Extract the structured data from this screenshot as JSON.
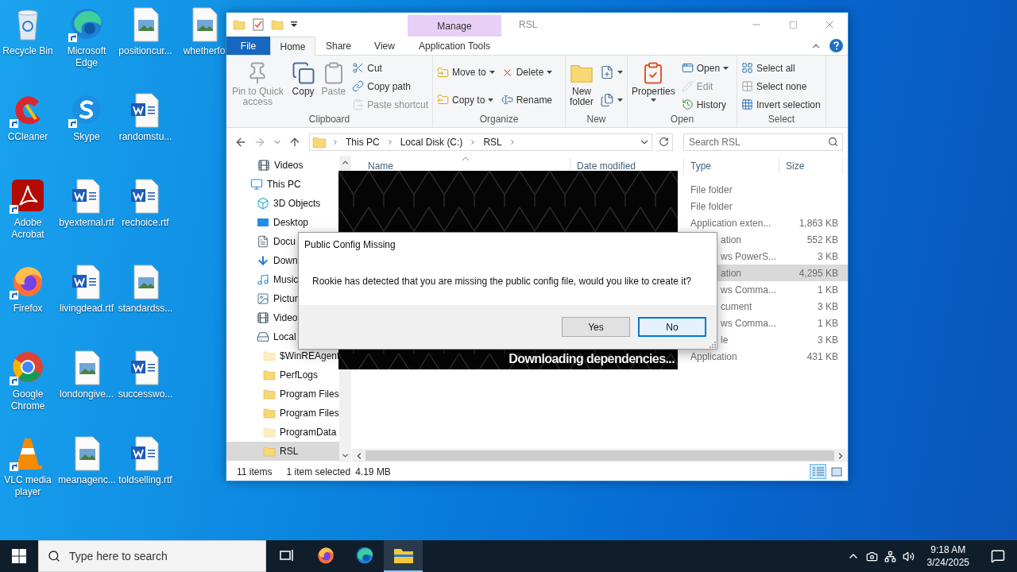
{
  "desktop_rows": [
    [
      {
        "label": "Recycle Bin",
        "kind": "recycle-bin",
        "shortcut": false
      },
      {
        "label": "Microsoft Edge",
        "kind": "edge",
        "shortcut": true
      },
      {
        "label": "positioncur...",
        "kind": "image-file",
        "shortcut": false
      },
      {
        "label": "whetherfo",
        "kind": "image-file",
        "shortcut": false
      }
    ],
    [
      {
        "label": "CCleaner",
        "kind": "ccleaner",
        "shortcut": true
      },
      {
        "label": "Skype",
        "kind": "skype",
        "shortcut": true
      },
      {
        "label": "randomstu...",
        "kind": "word-file",
        "shortcut": false
      }
    ],
    [
      {
        "label": "Adobe Acrobat",
        "kind": "acrobat",
        "shortcut": true
      },
      {
        "label": "byexternal.rtf",
        "kind": "word-file",
        "shortcut": false
      },
      {
        "label": "rechoice.rtf",
        "kind": "word-file",
        "shortcut": false
      }
    ],
    [
      {
        "label": "Firefox",
        "kind": "firefox",
        "shortcut": true
      },
      {
        "label": "livingdead.rtf",
        "kind": "word-file",
        "shortcut": false
      },
      {
        "label": "standardss...",
        "kind": "image-file",
        "shortcut": false
      }
    ],
    [
      {
        "label": "Google Chrome",
        "kind": "chrome",
        "shortcut": true
      },
      {
        "label": "londongive...",
        "kind": "image-file",
        "shortcut": false
      },
      {
        "label": "successwo...",
        "kind": "word-file",
        "shortcut": false
      }
    ],
    [
      {
        "label": "VLC media player",
        "kind": "vlc",
        "shortcut": true
      },
      {
        "label": "meanagenc...",
        "kind": "image-file",
        "shortcut": false
      },
      {
        "label": "toldselling.rtf",
        "kind": "word-file",
        "shortcut": false
      }
    ]
  ],
  "explorer": {
    "title": "RSL",
    "contextual_tab": "Manage",
    "tabs": [
      {
        "label": "File",
        "kind": "file",
        "selected": false
      },
      {
        "label": "Home",
        "kind": "tab",
        "selected": true
      },
      {
        "label": "Share",
        "kind": "tab",
        "selected": false
      },
      {
        "label": "View",
        "kind": "tab",
        "selected": false
      },
      {
        "label": "Application Tools",
        "kind": "tab",
        "selected": false
      }
    ],
    "ribbon_groups": [
      {
        "label": "Clipboard",
        "columns": [
          [
            {
              "label": "Pin to Quick access",
              "kind": "pin",
              "disabled": true,
              "dropdown": false
            }
          ],
          [
            {
              "label": "Copy",
              "kind": "copy",
              "disabled": false,
              "dropdown": false
            }
          ],
          [
            {
              "label": "Paste",
              "kind": "paste",
              "disabled": true,
              "dropdown": false
            }
          ],
          [
            {
              "label": "Cut",
              "kind": "cut",
              "disabled": false,
              "dropdown": false
            },
            {
              "label": "Copy path",
              "kind": "copy-path",
              "disabled": false,
              "dropdown": false
            },
            {
              "label": "Paste shortcut",
              "kind": "paste-shortcut",
              "disabled": true,
              "dropdown": false
            }
          ]
        ]
      },
      {
        "label": "Organize",
        "columns": [
          [
            {
              "label": "Move to",
              "kind": "move",
              "disabled": false,
              "dropdown": true
            },
            {
              "label": "Copy to",
              "kind": "copy-to",
              "disabled": false,
              "dropdown": true
            }
          ],
          [
            {
              "label": "Delete",
              "kind": "delete",
              "disabled": false,
              "dropdown": true
            },
            {
              "label": "Rename",
              "kind": "rename",
              "disabled": false,
              "dropdown": false
            }
          ]
        ]
      },
      {
        "label": "New",
        "columns": [
          [
            {
              "label": "New folder",
              "kind": "new-folder",
              "disabled": false,
              "dropdown": false
            }
          ],
          [
            {
              "kind": "new-item",
              "disabled": false,
              "dropdown": true
            },
            {
              "kind": "easy-access",
              "disabled": false,
              "dropdown": true
            }
          ]
        ]
      },
      {
        "label": "Open",
        "columns": [
          [
            {
              "label": "Properties",
              "kind": "properties",
              "disabled": false,
              "dropdown": true
            }
          ],
          [
            {
              "label": "Open",
              "kind": "open",
              "disabled": false,
              "dropdown": true
            },
            {
              "label": "Edit",
              "kind": "edit",
              "disabled": true,
              "dropdown": false
            },
            {
              "label": "History",
              "kind": "history",
              "disabled": false,
              "dropdown": false
            }
          ]
        ]
      },
      {
        "label": "Select",
        "columns": [
          [
            {
              "label": "Select all",
              "kind": "select-all",
              "disabled": false,
              "dropdown": false
            },
            {
              "label": "Select none",
              "kind": "select-none",
              "disabled": false,
              "dropdown": false
            },
            {
              "label": "Invert selection",
              "kind": "invert",
              "disabled": false,
              "dropdown": false
            }
          ]
        ]
      }
    ],
    "breadcrumbs": [
      "This PC",
      "Local Disk (C:)",
      "RSL"
    ],
    "search": {
      "placeholder": "Search RSL"
    },
    "quick_access": [
      {
        "label": "Videos",
        "kind": "video"
      }
    ],
    "tree": [
      {
        "label": "This PC",
        "kind": "pc",
        "selected": false,
        "children": [
          {
            "label": "3D Objects",
            "kind": "cube",
            "selected": false
          },
          {
            "label": "Desktop",
            "kind": "desktop",
            "selected": false
          },
          {
            "label": "Docu",
            "kind": "document",
            "selected": false
          },
          {
            "label": "Down",
            "kind": "download",
            "selected": false
          },
          {
            "label": "Music",
            "kind": "music",
            "selected": false
          },
          {
            "label": "Pictur",
            "kind": "picture",
            "selected": false
          },
          {
            "label": "Video",
            "kind": "video",
            "selected": false
          },
          {
            "label": "Local",
            "kind": "drive",
            "selected": false,
            "children": [
              {
                "label": "$WinREAgent",
                "kind": "folder",
                "hidden": true,
                "selected": false
              },
              {
                "label": "PerfLogs",
                "kind": "folder",
                "hidden": false,
                "selected": false
              },
              {
                "label": "Program Files",
                "kind": "folder",
                "hidden": false,
                "selected": false
              },
              {
                "label": "Program Files",
                "kind": "folder",
                "hidden": false,
                "selected": false
              },
              {
                "label": "ProgramData",
                "kind": "folder",
                "hidden": true,
                "selected": false
              },
              {
                "label": "RSL",
                "kind": "folder",
                "hidden": false,
                "selected": true
              }
            ]
          }
        ]
      }
    ],
    "columns": [
      "Name",
      "Date modified",
      "Type",
      "Size"
    ],
    "rows": [
      {
        "type": "File folder",
        "selected": false
      },
      {
        "type": "File folder",
        "selected": false
      },
      {
        "type": "Application exten...",
        "size": "1,863 KB",
        "covered": false,
        "selected": false
      },
      {
        "type": "ation",
        "size": "552 KB",
        "covered": true,
        "selected": false
      },
      {
        "type": "ws PowerS...",
        "size": "3 KB",
        "covered": true,
        "selected": false
      },
      {
        "type": "ation",
        "size": "4,295 KB",
        "covered": true,
        "selected": true
      },
      {
        "type": "ws Comma...",
        "size": "1 KB",
        "covered": true,
        "selected": false
      },
      {
        "type": "cument",
        "size": "3 KB",
        "covered": true,
        "selected": false
      },
      {
        "type": "ws Comma...",
        "size": "1 KB",
        "covered": true,
        "selected": false
      },
      {
        "type": "le",
        "size": "3 KB",
        "covered": true,
        "selected": false
      },
      {
        "type": "Application",
        "size": "431 KB",
        "covered": false,
        "selected": false
      }
    ],
    "status": {
      "count": "11 items",
      "selection": "1 item selected",
      "size": "4.19 MB"
    },
    "view_buttons": [
      {
        "kind": "details",
        "selected": true
      },
      {
        "kind": "large-icons",
        "selected": false
      }
    ]
  },
  "splash": {
    "caption": "Downloading dependencies..."
  },
  "dialog": {
    "title": "Public Config Missing",
    "message": "Rookie has detected that you are missing the public config file, would you like to create it?",
    "buttons": [
      {
        "label": "Yes",
        "focused": false
      },
      {
        "label": "No",
        "focused": true
      }
    ]
  },
  "taskbar": {
    "search_placeholder": "Type here to search",
    "apps": [
      {
        "kind": "task-view",
        "active": false
      },
      {
        "kind": "firefox",
        "active": false
      },
      {
        "kind": "edge",
        "active": false
      },
      {
        "kind": "file-explorer",
        "active": true
      }
    ],
    "time": "9:18 AM",
    "date": "3/24/2025"
  }
}
